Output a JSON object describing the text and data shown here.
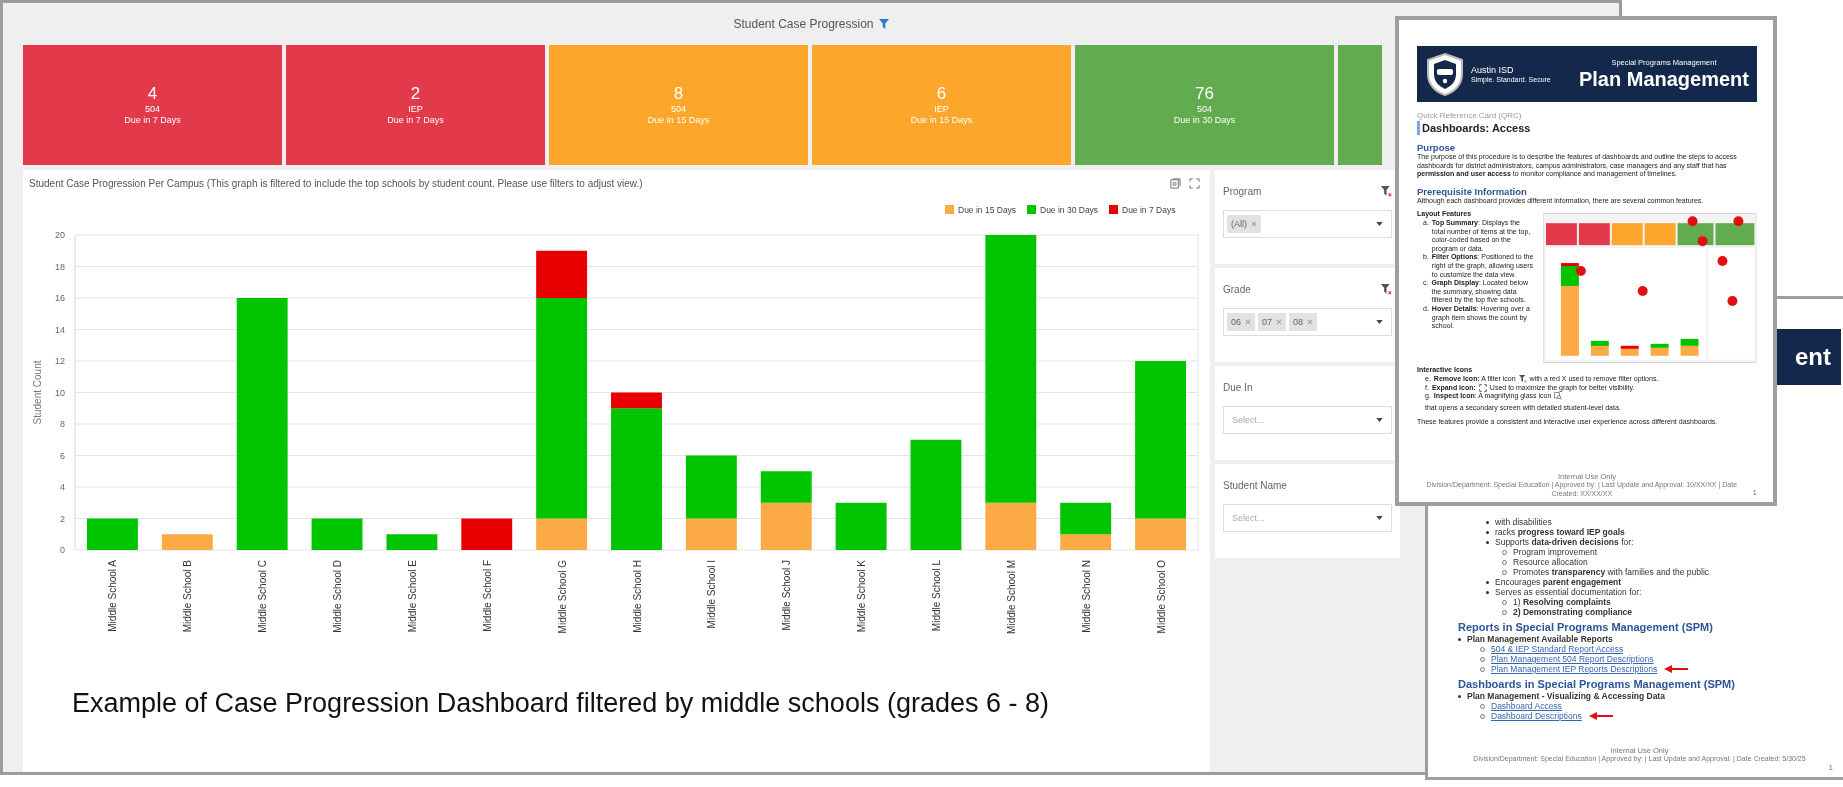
{
  "dashboard": {
    "title": "Student Case Progression",
    "tiles": [
      {
        "count": "4",
        "program": "504",
        "due": "Due in 7 Days",
        "color": "#e23a4b"
      },
      {
        "count": "2",
        "program": "IEP",
        "due": "Due in 7 Days",
        "color": "#e23a4b"
      },
      {
        "count": "8",
        "program": "504",
        "due": "Due in 15 Days",
        "color": "#fca62b"
      },
      {
        "count": "6",
        "program": "IEP",
        "due": "Due in 15 Days",
        "color": "#fca62b"
      },
      {
        "count": "76",
        "program": "504",
        "due": "Due in 30 Days",
        "color": "#63ab4f"
      },
      {
        "color": "#63ab4f"
      }
    ],
    "chart_panel": {
      "title": "Student Case Progression Per Campus (This graph is filtered to include the top schools by student count. Please use filters to adjust view.)",
      "chart_data": {
        "type": "bar",
        "ylabel": "Student Count",
        "stacked": true,
        "grid": true,
        "legend": true,
        "ylim": [
          0,
          20
        ],
        "yticks": [
          0,
          2,
          4,
          6,
          8,
          10,
          12,
          14,
          16,
          18,
          20
        ],
        "categories": [
          "Middle School A",
          "Middle School B",
          "Middle School C",
          "Middle School D",
          "Middle School E",
          "Middle School F",
          "Middle School G",
          "Middle School H",
          "Middle School I",
          "Middle School J",
          "Middle School K",
          "Middle School L",
          "Middle School M",
          "Middle School N",
          "Middle School O"
        ],
        "series": [
          {
            "name": "Due in 15 Days",
            "color": "#fbaa45",
            "values": [
              0,
              1,
              0,
              0,
              0,
              0,
              2,
              0,
              2,
              3,
              0,
              0,
              3,
              1,
              2
            ]
          },
          {
            "name": "Due in 30 Days",
            "color": "#00c400",
            "values": [
              2,
              0,
              16,
              2,
              1,
              0,
              14,
              9,
              4,
              2,
              3,
              7,
              17,
              2,
              10
            ]
          },
          {
            "name": "Due in 7 Days",
            "color": "#e80000",
            "values": [
              0,
              0,
              0,
              0,
              0,
              2,
              3,
              1,
              0,
              0,
              0,
              0,
              0,
              0,
              0
            ]
          }
        ]
      }
    },
    "filters": [
      {
        "label": "Program",
        "clear_icon": true,
        "chips": [
          "(All)"
        ]
      },
      {
        "label": "Grade",
        "clear_icon": true,
        "chips": [
          "06",
          "07",
          "08"
        ]
      },
      {
        "label": "Due In",
        "clear_icon": false,
        "placeholder": "Select..."
      },
      {
        "label": "Student Name",
        "clear_icon": false,
        "placeholder": "Select..."
      }
    ]
  },
  "caption": "Example of Case Progression Dashboard filtered by middle schools (grades 6 - 8)",
  "reference_card": {
    "org": "Austin ISD",
    "tagline": "Simple. Standard. Secure",
    "program": "Special Programs Management",
    "title": "Plan Management",
    "doc_type": "Quick Reference Card (QRC)",
    "heading": "Dashboards: Access",
    "purpose_heading": "Purpose",
    "purpose_text": "The purpose of this procedure is to describe the features of dashboards and outline the steps to access dashboards for district administrators, campus administrators, case managers and any staff that has **permission and user access** to monitor compliance and management of timelines.",
    "prereq_heading": "Prerequisite Information",
    "prereq_text": "Although each dashboard provides different information, there are several common features.",
    "layout_heading": "Layout Features",
    "layout_items": [
      {
        "marker": "a.",
        "text": "**Top Summary**: Displays the total number of items at the top, color-coded based on the program or data."
      },
      {
        "marker": "b.",
        "text": "**Filter Options**: Positioned to the right of the graph, allowing users to customize the data view."
      },
      {
        "marker": "c.",
        "text": "**Graph Display**: Located below the summary, showing data filtered by the top five schools."
      },
      {
        "marker": "d.",
        "text": "**Hover Details**: Hovering over a graph item shows the count by school."
      }
    ],
    "icons_heading": "Interactive Icons",
    "icon_items": [
      {
        "marker": "e.",
        "kind": "remove",
        "before": "**Remove Icon:** A filter icon",
        "after": "with a red X used to remove filter options."
      },
      {
        "marker": "f.",
        "kind": "expand",
        "before": "**Expand Icon:**",
        "after": "Used to maximize the graph for better visibility."
      },
      {
        "marker": "g.",
        "kind": "inspect",
        "before": "**Inspect Icon**: A magnifying glass icon",
        "after": "that opens a secondary screen with detailed student-level data."
      }
    ],
    "closing": "These features provide a consistent and interactive user experience across different dashboards.",
    "footer_note": "Internal Use Only",
    "footer": "Division/Department: Special Education | Approved by: | Last Update and Approval: 10/XX/XX | Date Created: XX/XX/XX",
    "page": "1"
  },
  "second_page": {
    "banner_text": "ent",
    "bullets": [
      {
        "text": "with disabilities"
      },
      {
        "text": "racks **progress toward IEP goals**"
      },
      {
        "text": "Supports **data-driven decisions** for:",
        "children": [
          {
            "text": "Program improvement"
          },
          {
            "text": "Resource allocation"
          },
          {
            "text": "Promotes **transparency** with families and the public"
          }
        ]
      },
      {
        "text": "Encourages **parent engagement**"
      },
      {
        "text": "Serves as essential documentation for:",
        "children": [
          {
            "text": "1) **Resolving complaints**"
          },
          {
            "text": "**2) Demonstrating compliance**"
          }
        ]
      }
    ],
    "sections": [
      {
        "heading": "Reports in Special Programs Management (SPM)",
        "item": "Plan Management Available Reports",
        "links": [
          {
            "text": "504 & IEP Standard Report Access",
            "arrow": false
          },
          {
            "text": "Plan Management 504 Report Descriptions",
            "arrow": false
          },
          {
            "text": "Plan Management IEP Reports Descriptions",
            "arrow": true
          }
        ]
      },
      {
        "heading": "Dashboards in Special Programs Management (SPM)",
        "item": "Plan Management - Visualizing & Accessing Data",
        "links": [
          {
            "text": "Dashboard Access",
            "arrow": false
          },
          {
            "text": "Dashboard Descriptions",
            "arrow": true
          }
        ]
      }
    ],
    "footer_note": "Internal Use Only",
    "footer": "Division/Department: Special Education | Approved by: | Last Update and Approval: | Date Created: 5/30/25",
    "page": "1"
  }
}
